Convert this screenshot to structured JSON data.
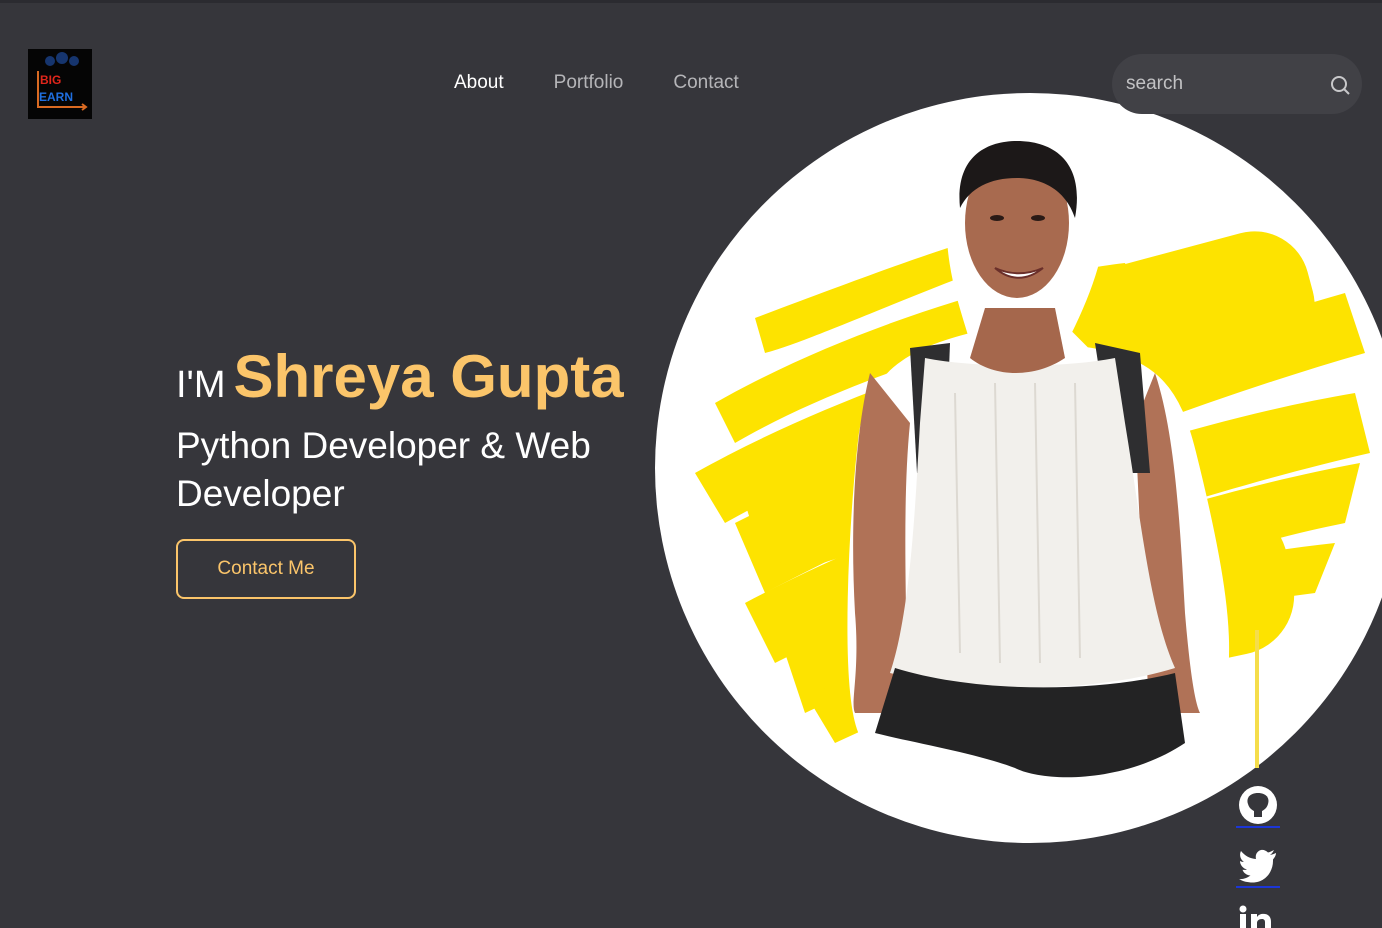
{
  "logo": {
    "line1": "BIG",
    "line2": "EARN"
  },
  "nav": {
    "items": [
      {
        "label": "About",
        "active": true
      },
      {
        "label": "Portfolio",
        "active": false
      },
      {
        "label": "Contact",
        "active": false
      }
    ]
  },
  "search": {
    "placeholder": "search",
    "icon": "search-icon"
  },
  "hero": {
    "prefix": "I'M",
    "name": "Shreya Gupta",
    "role": "Python Developer & Web Developer",
    "cta_label": "Contact Me"
  },
  "social": {
    "icons": [
      "github-icon",
      "twitter-icon",
      "linkedin-icon"
    ]
  },
  "colors": {
    "background": "#36363b",
    "accent": "#fbc56a",
    "highlight_yellow": "#fde300",
    "line_yellow": "#f5dd4b"
  }
}
